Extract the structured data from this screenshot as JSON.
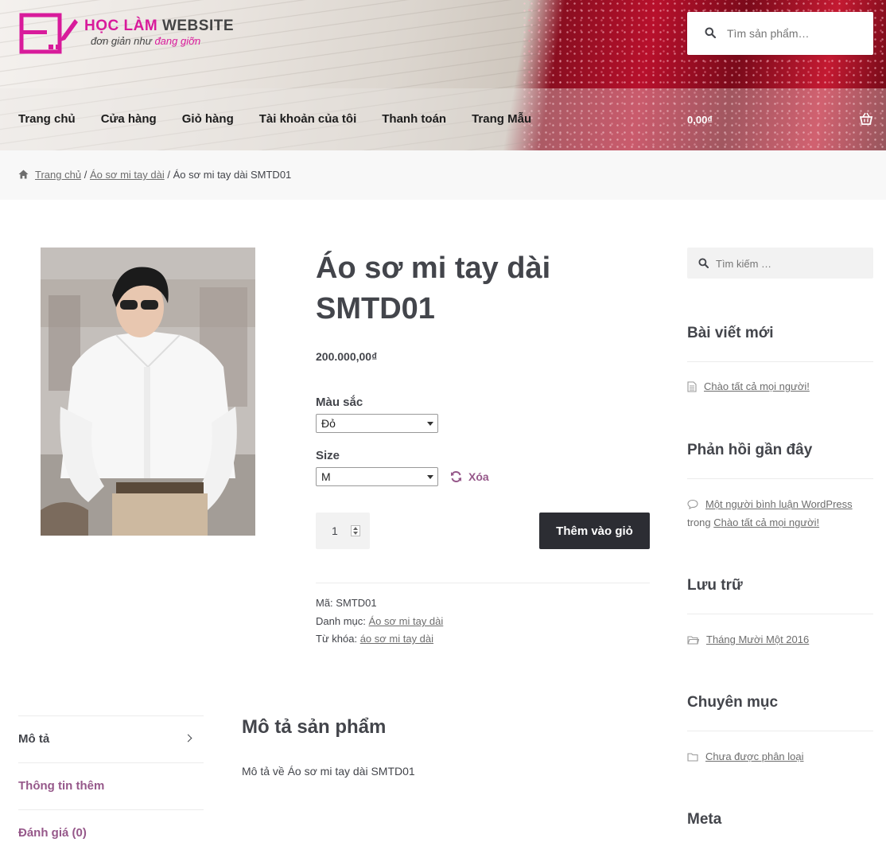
{
  "header": {
    "brand_part1": "HỌC LÀM",
    "brand_part2": "WEBSITE",
    "tagline_part1": "đơn giản như",
    "tagline_part2": "đang giỡn",
    "search_placeholder": "Tìm sản phẩm…",
    "nav": [
      "Trang chủ",
      "Cửa hàng",
      "Giỏ hàng",
      "Tài khoản của tôi",
      "Thanh toán",
      "Trang Mẫu"
    ],
    "cart_total": "0,00₫"
  },
  "breadcrumb": {
    "home": "Trang chủ",
    "sep": "/",
    "category": "Áo sơ mi tay dài",
    "current": "Áo sơ mi tay dài SMTD01"
  },
  "product": {
    "title": "Áo sơ mi tay dài SMTD01",
    "price": "200.000,00₫",
    "color_label": "Màu sắc",
    "color_value": "Đỏ",
    "size_label": "Size",
    "size_value": "M",
    "reset_label": "Xóa",
    "quantity": "1",
    "add_to_cart": "Thêm vào giỏ",
    "sku_label": "Mã:",
    "sku": "SMTD01",
    "category_label": "Danh mục:",
    "category": "Áo sơ mi tay dài",
    "tag_label": "Từ khóa:",
    "tag": "áo sơ mi tay dài"
  },
  "tabs": [
    {
      "label": "Mô tả"
    },
    {
      "label": "Thông tin thêm"
    },
    {
      "label": "Đánh giá (0)"
    }
  ],
  "description": {
    "heading": "Mô tả sản phẩm",
    "text": "Mô tả về Áo sơ mi tay dài SMTD01"
  },
  "sidebar": {
    "search_placeholder": "Tìm kiếm …",
    "recent_posts_title": "Bài viết mới",
    "recent_post": "Chào tất cả mọi người!",
    "recent_comments_title": "Phản hồi gần đây",
    "comment_author": "Một người bình luận WordPress",
    "comment_on": "trong",
    "comment_post": "Chào tất cả mọi người!",
    "archives_title": "Lưu trữ",
    "archive_item": "Tháng Mười Một 2016",
    "categories_title": "Chuyên mục",
    "category_item": "Chưa được phân loại",
    "meta_title": "Meta"
  },
  "colors": {
    "accent": "#96588a",
    "brand_pink": "#d81b9b",
    "button_dark": "#2c2d33",
    "text": "#43454b"
  }
}
